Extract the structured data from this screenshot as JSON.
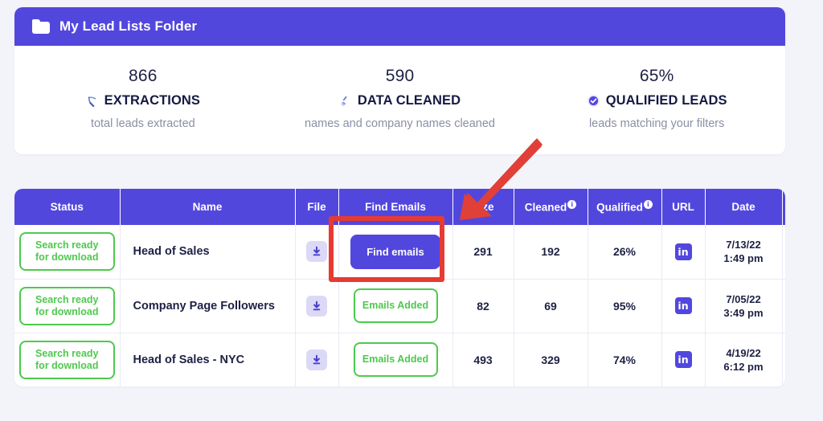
{
  "folder": {
    "icon": "folder-icon",
    "title": "My Lead Lists Folder"
  },
  "stats": [
    {
      "value": "866",
      "label": "EXTRACTIONS",
      "sub": "total leads extracted",
      "icon": "pickaxe-icon",
      "glyph": "⛏"
    },
    {
      "value": "590",
      "label": "DATA CLEANED",
      "sub": "names and company names cleaned",
      "icon": "broom-icon",
      "glyph": "🧹"
    },
    {
      "value": "65%",
      "label": "QUALIFIED LEADS",
      "sub": "leads matching your filters",
      "icon": "check-circle-icon",
      "glyph": "✔"
    }
  ],
  "table": {
    "columns": [
      {
        "label": "Status",
        "info": false
      },
      {
        "label": "Name",
        "info": false
      },
      {
        "label": "File",
        "info": false
      },
      {
        "label": "Find Emails",
        "info": false
      },
      {
        "label": "Size",
        "info": false
      },
      {
        "label": "Cleaned",
        "info": true
      },
      {
        "label": "Qualified",
        "info": true
      },
      {
        "label": "URL",
        "info": false
      },
      {
        "label": "Date",
        "info": false
      },
      {
        "label": "",
        "info": false
      }
    ],
    "info_glyph": "i",
    "rows": [
      {
        "status": "Search ready for download",
        "name": "Head of Sales",
        "file_icon": "download-icon",
        "find_emails_type": "button",
        "find_emails_label": "Find emails",
        "size": "291",
        "cleaned": "192",
        "qualified": "26%",
        "url_icon": "linkedin-icon",
        "url_label": "in",
        "date": "7/13/22",
        "time": "1:49 pm",
        "settings_icon": "gear-icon"
      },
      {
        "status": "Search ready for download",
        "name": "Company Page Followers",
        "file_icon": "download-icon",
        "find_emails_type": "badge",
        "find_emails_label": "Emails Added",
        "size": "82",
        "cleaned": "69",
        "qualified": "95%",
        "url_icon": "linkedin-icon",
        "url_label": "in",
        "date": "7/05/22",
        "time": "3:49 pm",
        "settings_icon": "gear-icon"
      },
      {
        "status": "Search ready for download",
        "name": "Head of Sales - NYC",
        "file_icon": "download-icon",
        "find_emails_type": "badge",
        "find_emails_label": "Emails Added",
        "size": "493",
        "cleaned": "329",
        "qualified": "74%",
        "url_icon": "linkedin-icon",
        "url_label": "in",
        "date": "4/19/22",
        "time": "6:12 pm",
        "settings_icon": "gear-icon"
      }
    ]
  },
  "annotations": {
    "highlight_color": "#e63b33",
    "arrow_color": "#e04038",
    "highlight_target": "find-emails-button",
    "arrow_target": "find-emails-button"
  },
  "colors": {
    "primary": "#5247dd",
    "page_background": "#f3f3fa",
    "badge_green": "#4ec94e",
    "text_dark": "#1d2144",
    "text_muted": "#8b8fa3"
  }
}
